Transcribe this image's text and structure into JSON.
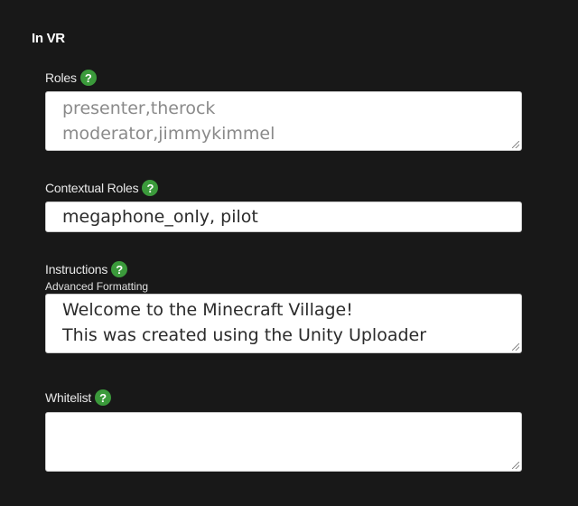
{
  "section": {
    "title": "In VR"
  },
  "help_glyph": "?",
  "colors": {
    "background": "#181818",
    "help_badge": "#3b9a3b"
  },
  "roles": {
    "label": "Roles",
    "placeholder_lines": [
      "presenter,therock",
      "moderator,jimmykimmel"
    ]
  },
  "contextual_roles": {
    "label": "Contextual Roles",
    "value": "megaphone_only, pilot"
  },
  "instructions": {
    "label": "Instructions",
    "sublabel": "Advanced Formatting",
    "value_lines": [
      "Welcome to the Minecraft Village!",
      "This was created using the Unity Uploader"
    ]
  },
  "whitelist": {
    "label": "Whitelist",
    "value": ""
  }
}
